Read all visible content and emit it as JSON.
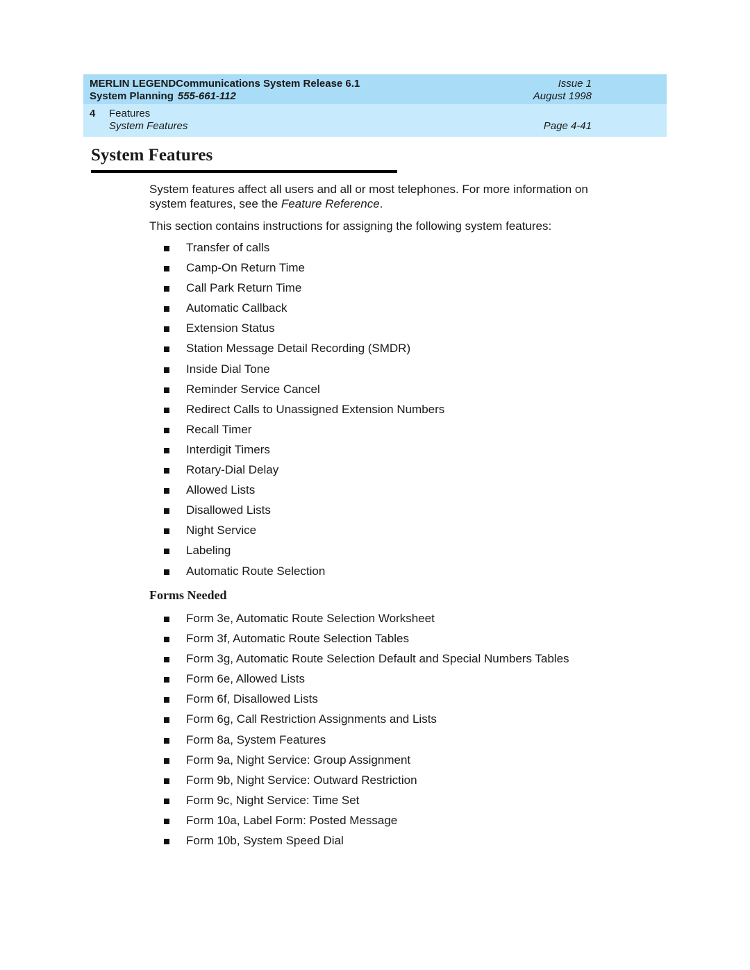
{
  "header": {
    "product": "MERLIN LEGENDCommunications System Release 6.1",
    "doc_title": "System Planning",
    "doc_number": "555-661-112",
    "issue": "Issue 1",
    "date": "August 1998",
    "chapter_number": "4",
    "chapter_title": "Features",
    "section_title": "System Features",
    "page": "Page 4-41"
  },
  "main": {
    "title": "System Features",
    "intro_pre": "System features affect all users and all or most telephones. For more information on system features, see the ",
    "intro_ref": "Feature Reference",
    "intro_post": ".",
    "list_intro": "This section contains instructions for assigning the following system features:",
    "features": [
      "Transfer of calls",
      "Camp-On Return Time",
      "Call Park Return Time",
      "Automatic Callback",
      "Extension Status",
      "Station Message Detail Recording (SMDR)",
      "Inside Dial Tone",
      "Reminder Service Cancel",
      "Redirect Calls to Unassigned Extension Numbers",
      "Recall Timer",
      "Interdigit Timers",
      "Rotary-Dial Delay",
      "Allowed Lists",
      "Disallowed Lists",
      "Night Service",
      "Labeling",
      "Automatic Route Selection"
    ],
    "forms_heading": "Forms Needed",
    "forms": [
      "Form 3e, Automatic Route Selection Worksheet",
      "Form 3f, Automatic Route Selection Tables",
      "Form 3g, Automatic Route Selection Default and Special Numbers Tables",
      "Form 6e, Allowed Lists",
      "Form 6f, Disallowed Lists",
      "Form 6g, Call Restriction Assignments and Lists",
      "Form 8a, System Features",
      "Form 9a, Night Service: Group Assignment",
      "Form 9b, Night Service: Outward Restriction",
      "Form 9c, Night Service: Time Set",
      "Form 10a, Label Form: Posted Message",
      "Form 10b, System Speed Dial"
    ]
  }
}
